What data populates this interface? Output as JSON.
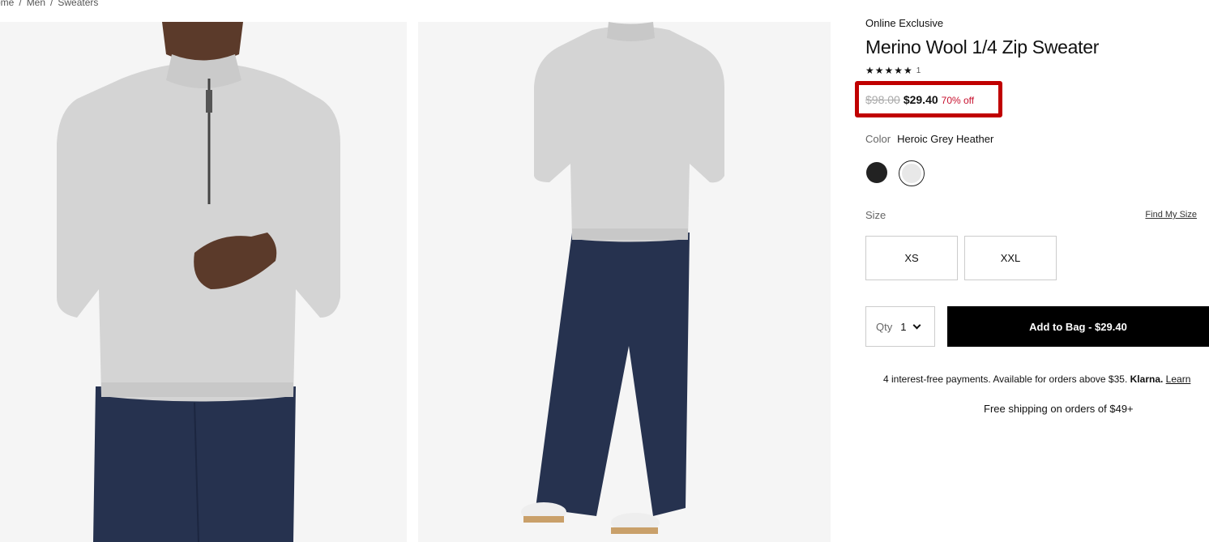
{
  "breadcrumb": {
    "items": [
      "ome",
      "/",
      "Men",
      "/",
      "Sweaters"
    ]
  },
  "product": {
    "badge": "Online Exclusive",
    "title": "Merino Wool 1/4 Zip Sweater",
    "stars": "★★★★★",
    "rating_count": "1",
    "price_original": "$98.00",
    "price_sale": "$29.40",
    "price_discount": "70% off",
    "color_label": "Color",
    "color_value": "Heroic Grey Heather",
    "swatches": [
      "black",
      "heroic-grey-heather"
    ],
    "size_label": "Size",
    "find_my_size": "Find My Size",
    "sizes": [
      "XS",
      "XXL"
    ],
    "qty_label": "Qty",
    "qty_value": "1",
    "add_to_bag": "Add to Bag  -  $29.40",
    "klarna_text": "4 interest-free payments. Available for orders above $35.",
    "klarna_brand": "Klarna.",
    "klarna_learn": "Learn",
    "shipping": "Free shipping on orders of $49+"
  },
  "colors": {
    "sale_red": "#c8102e",
    "highlight_red": "#c00000",
    "sweater_grey": "#d4d4d4",
    "pants_navy": "#26324f"
  }
}
